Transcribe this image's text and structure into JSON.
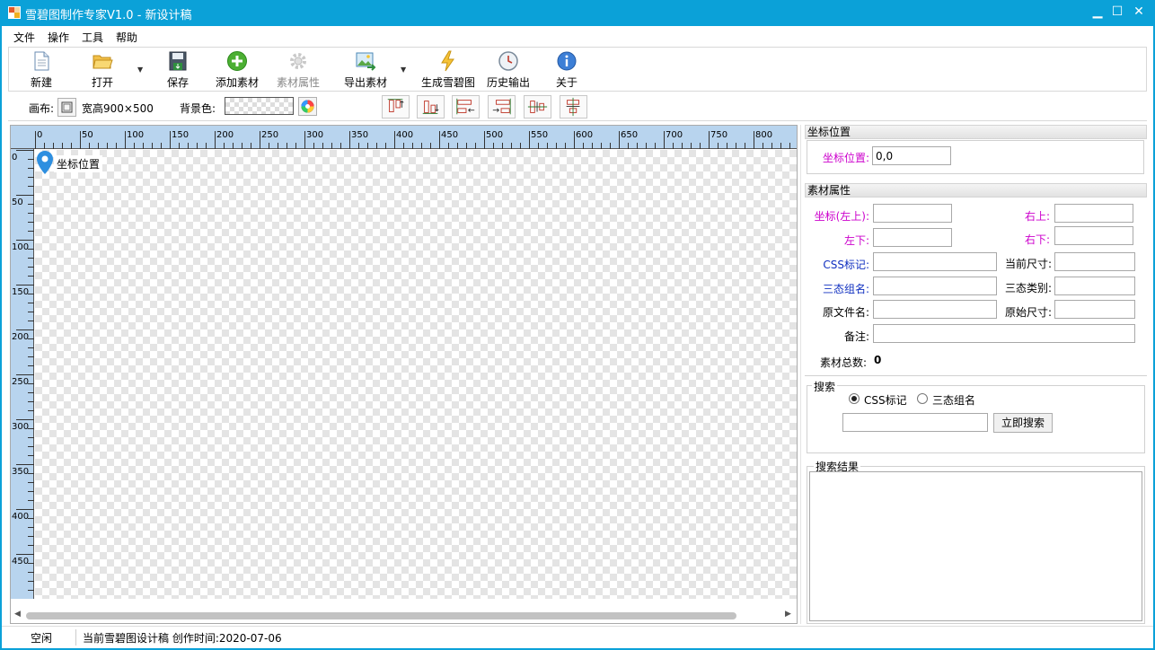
{
  "window": {
    "title": "雪碧图制作专家V1.0 - 新设计稿",
    "minimize": "▁",
    "maximize": "☐",
    "close": "✕"
  },
  "menu": [
    "文件",
    "操作",
    "工具",
    "帮助"
  ],
  "toolbar": {
    "new": "新建",
    "open": "打开",
    "save": "保存",
    "add_asset": "添加素材",
    "asset_props": "素材属性",
    "export_asset": "导出素材",
    "generate": "生成雪碧图",
    "history": "历史输出",
    "about": "关于"
  },
  "canvas_bar": {
    "canvas_label": "画布:",
    "size_text": "宽高900×500",
    "bg_label": "背景色:"
  },
  "ruler": {
    "h_ticks": [
      "0",
      "50",
      "100",
      "150",
      "200",
      "250",
      "300",
      "350",
      "400",
      "450",
      "500",
      "550",
      "600",
      "650",
      "700",
      "750",
      "800"
    ],
    "v_ticks": [
      "0",
      "50",
      "100",
      "150",
      "200",
      "250",
      "300",
      "350",
      "400",
      "450"
    ]
  },
  "canvas": {
    "marker_label": "坐标位置"
  },
  "coord_section": {
    "title": "坐标位置",
    "label": "坐标位置:",
    "value": "0,0"
  },
  "asset_section": {
    "title": "素材属性",
    "coord_tl": "坐标(左上):",
    "top_right": "右上:",
    "bottom_left": "左下:",
    "bottom_right": "右下:",
    "css_mark": "CSS标记:",
    "current_size": "当前尺寸:",
    "tristate_group": "三态组名:",
    "tristate_type": "三态类别:",
    "orig_filename": "原文件名:",
    "orig_size": "原始尺寸:",
    "note": "备注:",
    "total_label": "素材总数:",
    "total_value": "0"
  },
  "search": {
    "title": "搜索",
    "opt_css": "CSS标记",
    "opt_group": "三态组名",
    "button": "立即搜索",
    "results_title": "搜索结果"
  },
  "status": {
    "state": "空闲",
    "message": "当前雪碧图设计稿 创作时间:2020-07-06"
  }
}
